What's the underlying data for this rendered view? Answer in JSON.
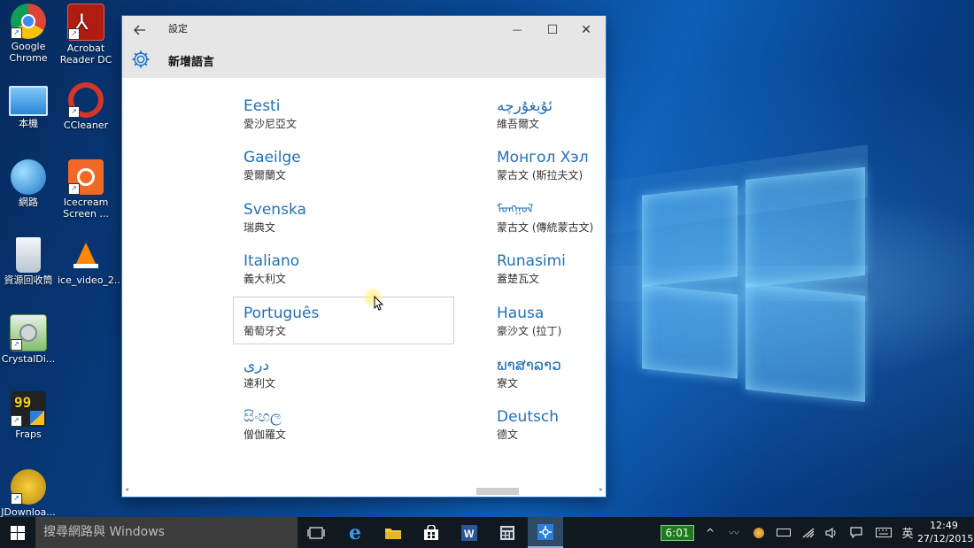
{
  "desktop": {
    "icons": [
      {
        "label": "Google\nChrome"
      },
      {
        "label": "Acrobat\nReader DC"
      },
      {
        "label": "本機"
      },
      {
        "label": "CCleaner"
      },
      {
        "label": "網路"
      },
      {
        "label": "Icecream\nScreen ..."
      },
      {
        "label": "資源回收筒"
      },
      {
        "label": "ice_video_2..."
      },
      {
        "label": "CrystalDi..."
      },
      {
        "label": "Fraps"
      },
      {
        "label": "JDownloa..."
      }
    ]
  },
  "window": {
    "title": "設定",
    "page_title": "新增語言",
    "back_icon": "arrow-left-icon",
    "controls": {
      "minimize": "—",
      "maximize": "☐",
      "close": "✕"
    }
  },
  "languages": {
    "left": [
      {
        "native": "Eesti",
        "translation": "愛沙尼亞文"
      },
      {
        "native": "Gaeilge",
        "translation": "愛爾蘭文"
      },
      {
        "native": "Svenska",
        "translation": "瑞典文"
      },
      {
        "native": "Italiano",
        "translation": "義大利文"
      },
      {
        "native": "Português",
        "translation": "葡萄牙文"
      },
      {
        "native": "دری",
        "translation": "達利文"
      },
      {
        "native": "සිංහල",
        "translation": "僧伽羅文"
      }
    ],
    "right": [
      {
        "native": "ئۇيغۇرچە",
        "translation": "維吾爾文"
      },
      {
        "native": "Монгол Хэл",
        "translation": "蒙古文 (斯拉夫文)"
      },
      {
        "native": "ᠮᠣᠩᠭᠣᠯ",
        "translation": "蒙古文 (傳統蒙古文)"
      },
      {
        "native": "Runasimi",
        "translation": "蓋楚瓦文"
      },
      {
        "native": "Hausa",
        "translation": "豪沙文 (拉丁)"
      },
      {
        "native": "ພາສາລາວ",
        "translation": "寮文"
      },
      {
        "native": "Deutsch",
        "translation": "德文"
      }
    ]
  },
  "taskbar": {
    "search_placeholder": "搜尋網路與 Windows",
    "battery_time": "6:01",
    "ime": "英",
    "time": "12:49",
    "date": "27/12/2015"
  },
  "colors": {
    "accent": "#2470b3",
    "taskbar": "#101820",
    "titlebar": "#e6e6e6"
  }
}
